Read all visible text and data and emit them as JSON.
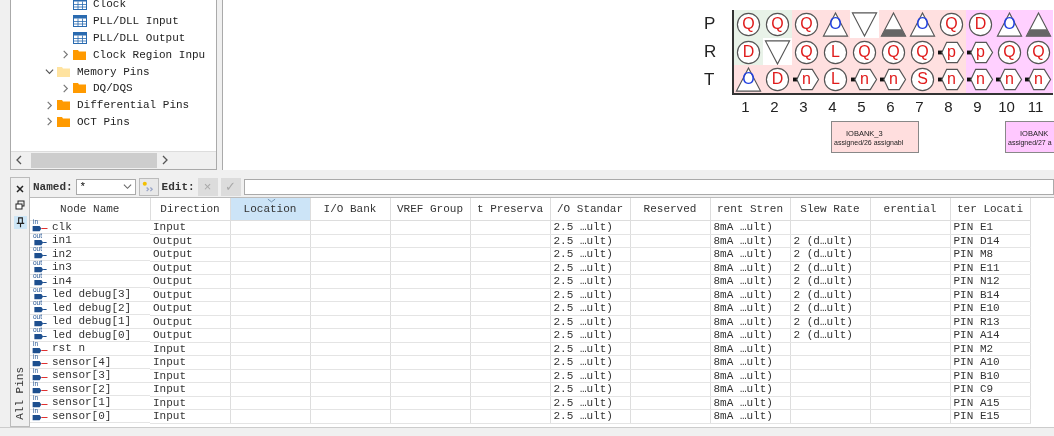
{
  "tree": [
    {
      "children": [
        {
          "children": [
            {
              "label": "Clock",
              "kind": "table"
            },
            {
              "label": "PLL/DLL Input",
              "kind": "table"
            },
            {
              "label": "PLL/DLL Output",
              "kind": "table"
            },
            {
              "label": "Clock Region Inpu",
              "kind": "folder",
              "expanded": false
            }
          ]
        },
        {
          "label": "Memory Pins",
          "kind": "folder",
          "expanded": true,
          "children": [
            {
              "label": "DQ/DQS",
              "kind": "folder",
              "expanded": false
            }
          ]
        },
        {
          "label": "Differential Pins",
          "kind": "folder",
          "expanded": false
        },
        {
          "label": "OCT Pins",
          "kind": "folder",
          "expanded": false
        }
      ]
    }
  ],
  "pin_grid": {
    "rows": [
      {
        "label": "P",
        "pins": [
          {
            "kind": "circle",
            "letter": "Q",
            "color": "#e8f2e8"
          },
          {
            "kind": "circle",
            "letter": "Q",
            "color": "#e8f2e8"
          },
          {
            "kind": "circle",
            "letter": "Q",
            "color": "#ffe0e0"
          },
          {
            "kind": "tri-up",
            "letter": "O",
            "color": "#ffe0e0"
          },
          {
            "kind": "tri-down",
            "color": "#ffffff"
          },
          {
            "kind": "tri-half",
            "color": "#ffe0e0"
          },
          {
            "kind": "tri-up",
            "letter": "O",
            "color": "#ffe0e0"
          },
          {
            "kind": "circle",
            "letter": "Q",
            "color": "#ffe0e0"
          },
          {
            "kind": "circle",
            "letter": "D",
            "color": "#ffd0ff"
          },
          {
            "kind": "tri-up",
            "letter": "O",
            "color": "#ffd0ff"
          },
          {
            "kind": "tri-half",
            "color": "#ffd0ff"
          }
        ]
      },
      {
        "label": "R",
        "pins": [
          {
            "kind": "circle",
            "letter": "D",
            "color": "#e8f2e8"
          },
          {
            "kind": "tri-down",
            "color": "#ffffff"
          },
          {
            "kind": "circle",
            "letter": "Q",
            "color": "#ffe0e0"
          },
          {
            "kind": "circle",
            "letter": "L",
            "color": "#ffe0e0"
          },
          {
            "kind": "circle",
            "letter": "Q",
            "color": "#ffe0e0"
          },
          {
            "kind": "circle",
            "letter": "Q",
            "color": "#ffe0e0"
          },
          {
            "kind": "circle",
            "letter": "Q",
            "color": "#ffe0e0"
          },
          {
            "kind": "hex",
            "letter": "p",
            "color": "#ffe0e0"
          },
          {
            "kind": "hex",
            "letter": "p",
            "color": "#ffd0ff"
          },
          {
            "kind": "circle",
            "letter": "Q",
            "color": "#ffd0ff"
          },
          {
            "kind": "circle",
            "letter": "Q",
            "color": "#ffd0ff"
          }
        ]
      },
      {
        "label": "T",
        "pins": [
          {
            "kind": "tri-up",
            "letter": "O",
            "color": "#ffe0e0"
          },
          {
            "kind": "circle",
            "letter": "D",
            "color": "#ffe0e0"
          },
          {
            "kind": "hex",
            "letter": "n",
            "color": "#ffe0e0"
          },
          {
            "kind": "circle",
            "letter": "L",
            "color": "#ffe0e0"
          },
          {
            "kind": "hex",
            "letter": "n",
            "color": "#ffe0e0"
          },
          {
            "kind": "hex",
            "letter": "n",
            "color": "#ffe0e0"
          },
          {
            "kind": "circle",
            "letter": "S",
            "color": "#ffe0e0"
          },
          {
            "kind": "hex",
            "letter": "n",
            "color": "#ffe0e0"
          },
          {
            "kind": "hex",
            "letter": "n",
            "color": "#ffd0ff"
          },
          {
            "kind": "hex",
            "letter": "n",
            "color": "#ffd0ff"
          },
          {
            "kind": "hex",
            "letter": "n",
            "color": "#ffd0ff"
          }
        ]
      }
    ],
    "columns": [
      "1",
      "2",
      "3",
      "4",
      "5",
      "6",
      "7",
      "8",
      "9",
      "10",
      "11"
    ],
    "banks": [
      {
        "name": "IOBANK_3",
        "summary": "assigned/26 assignabl",
        "color": "#ffdede"
      },
      {
        "name": "IOBANK",
        "summary": "assigned/27 a",
        "color": "#ffc8ff"
      }
    ]
  },
  "filter_bar": {
    "named_label": "Named:",
    "named_value": "*",
    "edit_label": "Edit:",
    "cancel": "×",
    "accept": "✓"
  },
  "side_tab": "All Pins",
  "table": {
    "columns": [
      {
        "label": "Node Name",
        "sorted": false
      },
      {
        "label": "Direction",
        "sorted": false
      },
      {
        "label": "Location",
        "sorted": true
      },
      {
        "label": "I/O Bank",
        "sorted": false
      },
      {
        "label": "VREF Group",
        "sorted": false
      },
      {
        "label": "t Preserva",
        "sorted": false
      },
      {
        "label": "/O Standar",
        "sorted": false
      },
      {
        "label": "Reserved",
        "sorted": false
      },
      {
        "label": "rent Stren",
        "sorted": false
      },
      {
        "label": "Slew Rate",
        "sorted": false
      },
      {
        "label": "erential",
        "sorted": false
      },
      {
        "label": "ter Locati",
        "sorted": false
      }
    ],
    "rows": [
      {
        "tag": "in",
        "name": "clk",
        "direction": "Input",
        "standard": "2.5 …ult)",
        "strength": "8mA …ult)",
        "fitter": "PIN E1"
      },
      {
        "tag": "out",
        "name": "in1",
        "direction": "Output",
        "standard": "2.5 …ult)",
        "strength": "8mA …ult)",
        "slew": "2 (d…ult)",
        "fitter": "PIN D14"
      },
      {
        "tag": "out",
        "name": "in2",
        "direction": "Output",
        "standard": "2.5 …ult)",
        "strength": "8mA …ult)",
        "slew": "2 (d…ult)",
        "fitter": "PIN M8"
      },
      {
        "tag": "out",
        "name": "in3",
        "direction": "Output",
        "standard": "2.5 …ult)",
        "strength": "8mA …ult)",
        "slew": "2 (d…ult)",
        "fitter": "PIN E11"
      },
      {
        "tag": "out",
        "name": "in4",
        "direction": "Output",
        "standard": "2.5 …ult)",
        "strength": "8mA …ult)",
        "slew": "2 (d…ult)",
        "fitter": "PIN N12"
      },
      {
        "tag": "out",
        "name": "led debug[3]",
        "direction": "Output",
        "standard": "2.5 …ult)",
        "strength": "8mA …ult)",
        "slew": "2 (d…ult)",
        "fitter": "PIN B14"
      },
      {
        "tag": "out",
        "name": "led debug[2]",
        "direction": "Output",
        "standard": "2.5 …ult)",
        "strength": "8mA …ult)",
        "slew": "2 (d…ult)",
        "fitter": "PIN E10"
      },
      {
        "tag": "out",
        "name": "led debug[1]",
        "direction": "Output",
        "standard": "2.5 …ult)",
        "strength": "8mA …ult)",
        "slew": "2 (d…ult)",
        "fitter": "PIN R13"
      },
      {
        "tag": "out",
        "name": "led debug[0]",
        "direction": "Output",
        "standard": "2.5 …ult)",
        "strength": "8mA …ult)",
        "slew": "2 (d…ult)",
        "fitter": "PIN A14"
      },
      {
        "tag": "in",
        "name": "rst n",
        "direction": "Input",
        "standard": "2.5 …ult)",
        "strength": "8mA …ult)",
        "fitter": "PIN M2"
      },
      {
        "tag": "in",
        "name": "sensor[4]",
        "direction": "Input",
        "standard": "2.5 …ult)",
        "strength": "8mA …ult)",
        "fitter": "PIN A10"
      },
      {
        "tag": "in",
        "name": "sensor[3]",
        "direction": "Input",
        "standard": "2.5 …ult)",
        "strength": "8mA …ult)",
        "fitter": "PIN B10"
      },
      {
        "tag": "in",
        "name": "sensor[2]",
        "direction": "Input",
        "standard": "2.5 …ult)",
        "strength": "8mA …ult)",
        "fitter": "PIN C9"
      },
      {
        "tag": "in",
        "name": "sensor[1]",
        "direction": "Input",
        "standard": "2.5 …ult)",
        "strength": "8mA …ult)",
        "fitter": "PIN A15"
      },
      {
        "tag": "in",
        "name": "sensor[0]",
        "direction": "Input",
        "standard": "2.5 …ult)",
        "strength": "8mA …ult)",
        "fitter": "PIN E15"
      }
    ]
  }
}
